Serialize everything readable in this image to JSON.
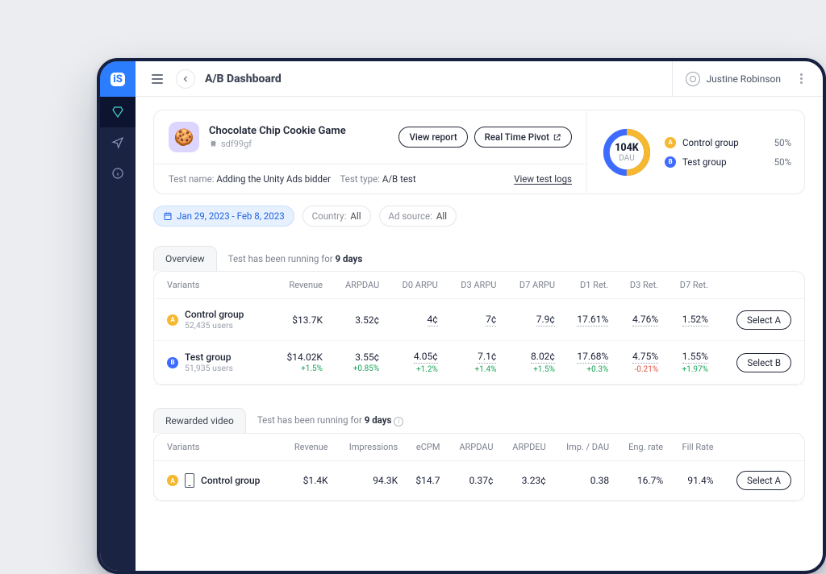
{
  "header": {
    "title": "A/B Dashboard",
    "user": "Justine Robinson"
  },
  "app": {
    "name": "Chocolate Chip Cookie Game",
    "id": "sdf99gf",
    "view_report": "View report",
    "real_time": "Real Time Pivot",
    "test_name_lbl": "Test name:",
    "test_name": "Adding the Unity Ads bidder",
    "test_type_lbl": "Test type:",
    "test_type": "A/B test",
    "view_logs": "View test logs"
  },
  "donut": {
    "value": "104K",
    "label": "DAU"
  },
  "legend": {
    "a": {
      "name": "Control group",
      "pct": "50%"
    },
    "b": {
      "name": "Test group",
      "pct": "50%"
    }
  },
  "filters": {
    "date": "Jan 29, 2023 - Feb 8, 2023",
    "country_lbl": "Country:",
    "country": "All",
    "source_lbl": "Ad source:",
    "source": "All"
  },
  "overview": {
    "tab": "Overview",
    "running_a": "Test has been running for ",
    "running_b": "9 days",
    "cols": [
      "Variants",
      "Revenue",
      "ARPDAU",
      "D0 ARPU",
      "D3 ARPU",
      "D7 ARPU",
      "D1 Ret.",
      "D3 Ret.",
      "D7 Ret.",
      ""
    ],
    "rows": [
      {
        "dot": "a",
        "name": "Control group",
        "sub": "52,435 users",
        "vals": [
          "$13.7K",
          "3.52¢",
          "4¢",
          "7¢",
          "7.9¢",
          "17.61%",
          "4.76%",
          "1.52%"
        ],
        "select": "Select A"
      },
      {
        "dot": "b",
        "name": "Test group",
        "sub": "51,935 users",
        "vals": [
          "$14.02K",
          "3.55¢",
          "4.05¢",
          "7.1¢",
          "8.02¢",
          "17.68%",
          "4.75%",
          "1.55%"
        ],
        "deltas": [
          "+1.5%",
          "+0.85%",
          "+1.2%",
          "+1.4%",
          "+1.5%",
          "+0.3%",
          "-0.21%",
          "+1.97%"
        ],
        "select": "Select B"
      }
    ]
  },
  "rewarded": {
    "tab": "Rewarded video",
    "running_a": "Test has been running for ",
    "running_b": "9 days",
    "cols": [
      "Variants",
      "Revenue",
      "Impressions",
      "eCPM",
      "ARPDAU",
      "ARPDEU",
      "Imp. / DAU",
      "Eng. rate",
      "Fill Rate",
      ""
    ],
    "rows": [
      {
        "dot": "a",
        "name": "Control group",
        "device": true,
        "vals": [
          "$1.4K",
          "94.3K",
          "$14.7",
          "0.37¢",
          "3.23¢",
          "0.38",
          "16.7%",
          "91.4%"
        ],
        "select": "Select A"
      }
    ]
  }
}
